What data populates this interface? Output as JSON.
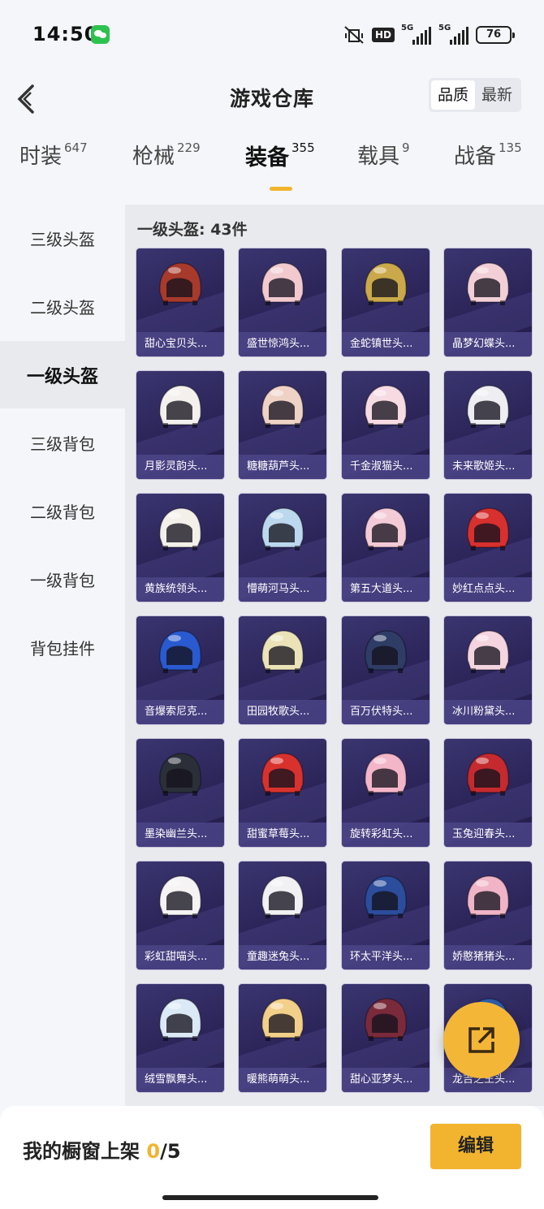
{
  "status": {
    "time": "14:50",
    "hd": "HD",
    "net1": "5G",
    "net2": "5G",
    "battery": "76"
  },
  "nav": {
    "title": "游戏仓库",
    "sort_options": [
      "品质",
      "最新"
    ],
    "sort_active": "品质"
  },
  "tabs": [
    {
      "label": "时装",
      "count": "647"
    },
    {
      "label": "枪械",
      "count": "229"
    },
    {
      "label": "装备",
      "count": "355",
      "active": true
    },
    {
      "label": "载具",
      "count": "9"
    },
    {
      "label": "战备",
      "count": "135"
    }
  ],
  "sidebar": {
    "items": [
      "三级头盔",
      "二级头盔",
      "一级头盔",
      "三级背包",
      "二级背包",
      "一级背包",
      "背包挂件"
    ],
    "active": "一级头盔"
  },
  "section": {
    "header": "一级头盔: 43件"
  },
  "items": [
    {
      "name": "甜心宝贝头...",
      "color": "#a83a2c"
    },
    {
      "name": "盛世惊鸿头...",
      "color": "#f1c9cf"
    },
    {
      "name": "金蛇镇世头...",
      "color": "#c9a94a"
    },
    {
      "name": "晶梦幻蝶头...",
      "color": "#f2cfd6"
    },
    {
      "name": "月影灵韵头...",
      "color": "#f3f0ee"
    },
    {
      "name": "糖糖葫芦头...",
      "color": "#efd2c6"
    },
    {
      "name": "千金淑猫头...",
      "color": "#f7dbe3"
    },
    {
      "name": "未来歌姬头...",
      "color": "#eeeef2"
    },
    {
      "name": "黄族统领头...",
      "color": "#f3f0ea"
    },
    {
      "name": "懵萌河马头...",
      "color": "#bcd8ee"
    },
    {
      "name": "第五大道头...",
      "color": "#f3cbd6"
    },
    {
      "name": "妙红点点头...",
      "color": "#d8302e"
    },
    {
      "name": "音爆索尼克...",
      "color": "#2a5ad0"
    },
    {
      "name": "田园牧歌头...",
      "color": "#ebe3b8"
    },
    {
      "name": "百万伏特头...",
      "color": "#2f3c66"
    },
    {
      "name": "冰川粉黛头...",
      "color": "#f4d4df"
    },
    {
      "name": "墨染幽兰头...",
      "color": "#2b2f38"
    },
    {
      "name": "甜蜜草莓头...",
      "color": "#d9322e"
    },
    {
      "name": "旋转彩虹头...",
      "color": "#f3b6c8"
    },
    {
      "name": "玉兔迎春头...",
      "color": "#c52a2e"
    },
    {
      "name": "彩虹甜喵头...",
      "color": "#f5f3f4"
    },
    {
      "name": "童趣迷兔头...",
      "color": "#f1f1f3"
    },
    {
      "name": "环太平洋头...",
      "color": "#2b4d9c"
    },
    {
      "name": "娇憨猪猪头...",
      "color": "#f0b4c6"
    },
    {
      "name": "绒雪飘舞头...",
      "color": "#dbe9f6"
    },
    {
      "name": "暖熊萌萌头...",
      "color": "#f3d08a"
    },
    {
      "name": "甜心亚梦头...",
      "color": "#7a2a3a"
    },
    {
      "name": "龙吉之王头...",
      "color": "#2c5fb0"
    }
  ],
  "bottom": {
    "shelf_label": "我的橱窗上架 ",
    "shelf_current": "0",
    "shelf_total": "/5",
    "edit_label": "编辑"
  },
  "colors": {
    "accent": "#f2b42e",
    "card_bg": "#2a2458",
    "card_label_bg": "#4b4487"
  }
}
